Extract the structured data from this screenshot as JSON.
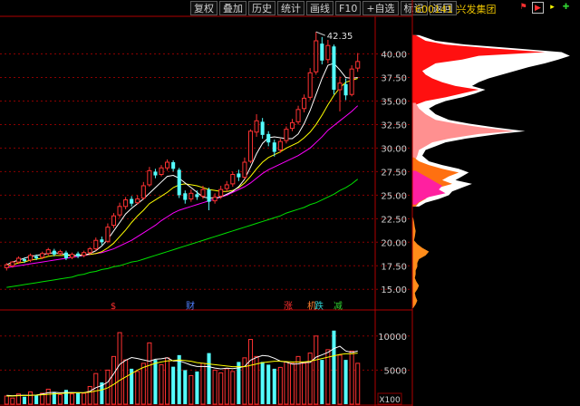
{
  "toolbar": {
    "buttons": [
      "复权",
      "叠加",
      "历史",
      "统计",
      "画线",
      "F10",
      "+自选",
      "标记",
      "返回"
    ]
  },
  "stock": {
    "code_name": "600141 兴发集团"
  },
  "price_axis": {
    "labels": [
      "40.00",
      "37.50",
      "35.00",
      "32.50",
      "30.00",
      "27.50",
      "25.00",
      "22.50",
      "20.00",
      "17.50",
      "15.00"
    ]
  },
  "annotations": {
    "high_label": "42.35"
  },
  "event_markers": [
    {
      "text": "$",
      "color": "#ff3030"
    },
    {
      "text": "财",
      "color": "#5080ff"
    },
    {
      "text": "涨",
      "color": "#ff3030"
    },
    {
      "text": "机",
      "color": "#ff8030"
    },
    {
      "text": "跌",
      "color": "#30d0d0"
    },
    {
      "text": "减",
      "color": "#30d030"
    }
  ],
  "volume_axis": {
    "labels": [
      "10000",
      "5000"
    ],
    "unit": "X100"
  },
  "colors": {
    "up": "#ff3232",
    "down": "#54fcfc",
    "ma5": "#ffffff",
    "ma10": "#ffff00",
    "ma20": "#ff00ff",
    "ma60": "#00e000"
  },
  "chart_data": {
    "type": "candlestick",
    "y_range": [
      13,
      44
    ],
    "high": 42.35,
    "candles": [
      [
        17.3,
        17.6,
        17.0,
        17.8
      ],
      [
        17.5,
        17.9,
        17.3,
        18.0
      ],
      [
        17.9,
        18.3,
        17.7,
        18.5
      ],
      [
        18.2,
        18.0,
        17.8,
        18.4
      ],
      [
        18.1,
        18.6,
        17.9,
        18.8
      ],
      [
        18.5,
        18.3,
        18.1,
        18.7
      ],
      [
        18.4,
        18.8,
        18.2,
        19.0
      ],
      [
        18.8,
        19.2,
        18.6,
        19.4
      ],
      [
        19.1,
        18.7,
        18.5,
        19.3
      ],
      [
        18.8,
        19.0,
        18.6,
        19.2
      ],
      [
        18.9,
        18.3,
        18.1,
        19.1
      ],
      [
        18.4,
        18.7,
        18.2,
        18.9
      ],
      [
        18.8,
        18.5,
        18.3,
        19.0
      ],
      [
        18.6,
        18.9,
        18.4,
        19.1
      ],
      [
        18.9,
        19.3,
        18.7,
        19.5
      ],
      [
        19.3,
        20.2,
        19.1,
        20.5
      ],
      [
        20.3,
        20.0,
        19.7,
        20.6
      ],
      [
        20.1,
        21.6,
        19.9,
        22.0
      ],
      [
        21.8,
        22.8,
        21.5,
        23.1
      ],
      [
        22.9,
        23.8,
        22.6,
        24.2
      ],
      [
        23.8,
        24.5,
        23.5,
        24.8
      ],
      [
        24.6,
        24.1,
        23.8,
        24.9
      ],
      [
        24.2,
        24.6,
        24.0,
        25.0
      ],
      [
        24.7,
        26.0,
        24.5,
        26.4
      ],
      [
        26.1,
        27.6,
        25.9,
        28.0
      ],
      [
        27.5,
        27.1,
        26.8,
        27.8
      ],
      [
        27.2,
        27.9,
        27.0,
        28.2
      ],
      [
        27.9,
        28.5,
        27.6,
        28.8
      ],
      [
        28.5,
        27.8,
        27.5,
        28.7
      ],
      [
        27.7,
        25.0,
        24.7,
        27.9
      ],
      [
        25.2,
        24.5,
        24.1,
        25.5
      ],
      [
        24.6,
        25.2,
        24.3,
        25.6
      ],
      [
        25.1,
        24.8,
        24.5,
        25.5
      ],
      [
        24.9,
        25.6,
        24.6,
        26.0
      ],
      [
        25.6,
        24.3,
        23.4,
        25.8
      ],
      [
        24.4,
        24.8,
        24.1,
        25.2
      ],
      [
        24.9,
        25.6,
        24.6,
        26.0
      ],
      [
        25.7,
        26.1,
        25.4,
        26.5
      ],
      [
        26.2,
        27.2,
        25.9,
        27.5
      ],
      [
        27.3,
        26.9,
        26.5,
        27.7
      ],
      [
        26.9,
        28.5,
        26.7,
        29.0
      ],
      [
        28.6,
        31.8,
        28.4,
        32.0
      ],
      [
        31.7,
        32.9,
        31.2,
        33.6
      ],
      [
        32.8,
        31.4,
        31.0,
        33.2
      ],
      [
        31.5,
        30.6,
        30.2,
        31.8
      ],
      [
        30.6,
        29.6,
        29.1,
        30.9
      ],
      [
        29.8,
        30.7,
        29.5,
        31.0
      ],
      [
        30.8,
        32.0,
        30.5,
        32.3
      ],
      [
        32.1,
        32.7,
        31.8,
        33.1
      ],
      [
        32.8,
        34.1,
        32.5,
        34.5
      ],
      [
        34.2,
        35.3,
        33.8,
        35.7
      ],
      [
        35.4,
        38.0,
        35.1,
        38.5
      ],
      [
        38.1,
        41.4,
        37.8,
        42.35
      ],
      [
        41.1,
        39.3,
        38.9,
        41.8
      ],
      [
        39.4,
        40.9,
        39.0,
        41.5
      ],
      [
        40.8,
        36.2,
        35.7,
        41.0
      ],
      [
        36.2,
        36.9,
        33.9,
        37.6
      ],
      [
        36.8,
        35.6,
        35.1,
        37.4
      ],
      [
        35.7,
        38.4,
        35.5,
        38.8
      ],
      [
        38.5,
        39.2,
        38.1,
        40.1
      ]
    ],
    "ma5": [
      17.6,
      17.9,
      18.1,
      18.3,
      18.5,
      18.6,
      18.7,
      18.8,
      18.9,
      18.8,
      18.7,
      18.6,
      18.6,
      18.6,
      18.8,
      19.1,
      19.6,
      20.3,
      21.2,
      22.1,
      23.0,
      23.6,
      24.1,
      24.6,
      25.2,
      25.8,
      26.4,
      27.0,
      27.1,
      26.8,
      26.3,
      25.8,
      25.3,
      24.8,
      24.7,
      24.7,
      24.8,
      25.1,
      25.4,
      25.9,
      26.7,
      28.0,
      29.4,
      30.5,
      31.1,
      31.2,
      31.1,
      31.0,
      31.0,
      31.5,
      32.6,
      34.0,
      35.7,
      37.4,
      38.8,
      39.0,
      38.3,
      37.5,
      37.4,
      37.5
    ],
    "ma10": [
      17.5,
      17.6,
      17.8,
      17.9,
      18.1,
      18.2,
      18.3,
      18.5,
      18.6,
      18.6,
      18.6,
      18.6,
      18.6,
      18.7,
      18.7,
      18.8,
      19.0,
      19.4,
      19.9,
      20.6,
      21.3,
      22.1,
      22.8,
      23.4,
      24.1,
      24.5,
      24.9,
      25.3,
      25.8,
      26.1,
      26.2,
      26.1,
      26.0,
      25.8,
      25.6,
      25.5,
      25.4,
      25.4,
      25.5,
      25.8,
      26.3,
      27.0,
      27.8,
      28.5,
      29.0,
      29.3,
      29.6,
      30.0,
      30.3,
      30.6,
      31.1,
      31.7,
      32.5,
      33.5,
      34.6,
      35.6,
      36.4,
      37.0,
      37.2,
      37.4
    ],
    "ma20": [
      17.3,
      17.4,
      17.5,
      17.6,
      17.7,
      17.8,
      17.9,
      18.0,
      18.1,
      18.2,
      18.3,
      18.4,
      18.5,
      18.6,
      18.7,
      18.8,
      18.9,
      19.1,
      19.3,
      19.6,
      19.9,
      20.2,
      20.6,
      21.0,
      21.4,
      21.8,
      22.3,
      22.7,
      23.1,
      23.4,
      23.6,
      23.8,
      24.0,
      24.2,
      24.4,
      24.6,
      24.8,
      25.0,
      25.3,
      25.6,
      25.9,
      26.3,
      26.8,
      27.3,
      27.7,
      28.0,
      28.3,
      28.6,
      28.9,
      29.2,
      29.6,
      30.0,
      30.6,
      31.2,
      31.9,
      32.4,
      32.9,
      33.4,
      33.9,
      34.5
    ],
    "ma60": [
      15.2,
      15.3,
      15.4,
      15.5,
      15.6,
      15.7,
      15.8,
      15.9,
      16.0,
      16.1,
      16.2,
      16.3,
      16.5,
      16.6,
      16.8,
      16.9,
      17.1,
      17.2,
      17.4,
      17.5,
      17.7,
      17.9,
      18.0,
      18.2,
      18.4,
      18.6,
      18.8,
      19.0,
      19.2,
      19.4,
      19.6,
      19.8,
      20.0,
      20.2,
      20.4,
      20.6,
      20.8,
      21.0,
      21.2,
      21.4,
      21.6,
      21.8,
      22.0,
      22.2,
      22.4,
      22.6,
      22.8,
      23.1,
      23.3,
      23.5,
      23.7,
      24.0,
      24.2,
      24.5,
      24.8,
      25.1,
      25.5,
      25.8,
      26.2,
      26.7
    ],
    "volume_range": [
      0,
      12500
    ],
    "volumes": [
      1200,
      900,
      1500,
      1100,
      1800,
      1300,
      1600,
      2200,
      1800,
      1400,
      2100,
      1500,
      1700,
      1600,
      2600,
      4500,
      3200,
      5000,
      7000,
      10500,
      6500,
      5200,
      4800,
      6000,
      9000,
      6500,
      5800,
      6800,
      5500,
      7200,
      5000,
      4200,
      4800,
      6000,
      7500,
      5000,
      4600,
      5200,
      4800,
      6200,
      6800,
      9500,
      7000,
      6200,
      5800,
      5200,
      5400,
      6200,
      6000,
      7000,
      6000,
      7500,
      10000,
      6500,
      8000,
      10800,
      7200,
      6500,
      7800,
      6000
    ],
    "vol_ma1": [
      1300,
      1250,
      1300,
      1320,
      1300,
      1350,
      1500,
      1680,
      1740,
      1680,
      1720,
      1720,
      1700,
      1680,
      1900,
      2420,
      2740,
      3240,
      4460,
      5840,
      6440,
      6840,
      6700,
      6500,
      6300,
      6600,
      6660,
      6820,
      6340,
      6360,
      6060,
      5740,
      5540,
      5540,
      5500,
      5300,
      5180,
      5280,
      5220,
      5340,
      5560,
      6460,
      6860,
      7140,
      7060,
      6740,
      6320,
      6160,
      5880,
      5920,
      6120,
      6140,
      6900,
      7240,
      7600,
      8160,
      8500,
      7800,
      7600,
      7800
    ],
    "vol_ma2": [
      1200,
      1200,
      1250,
      1280,
      1300,
      1330,
      1380,
      1450,
      1520,
      1560,
      1620,
      1650,
      1680,
      1700,
      1760,
      1950,
      2100,
      2400,
      2900,
      3500,
      4000,
      4500,
      5000,
      5400,
      5700,
      6000,
      6200,
      6350,
      6400,
      6500,
      6400,
      6300,
      6100,
      6000,
      5900,
      5800,
      5700,
      5600,
      5500,
      5500,
      5500,
      5700,
      5900,
      6100,
      6200,
      6300,
      6300,
      6250,
      6200,
      6200,
      6200,
      6300,
      6500,
      6700,
      6900,
      7100,
      7300,
      7400,
      7400,
      7500
    ]
  },
  "depth_profile": {
    "y_range": [
      13,
      44
    ],
    "bands": [
      {
        "color": "#ff1010",
        "points": [
          [
            42.0,
            0.02
          ],
          [
            41.4,
            0.08
          ],
          [
            41.0,
            0.2
          ],
          [
            40.6,
            0.48
          ],
          [
            40.2,
            0.8
          ],
          [
            39.8,
            0.4
          ],
          [
            39.4,
            0.3
          ],
          [
            39.0,
            0.14
          ],
          [
            38.6,
            0.1
          ],
          [
            38.2,
            0.06
          ],
          [
            37.8,
            0.08
          ],
          [
            37.4,
            0.12
          ],
          [
            37.0,
            0.18
          ],
          [
            36.6,
            0.26
          ],
          [
            36.2,
            0.4
          ],
          [
            35.8,
            0.3
          ],
          [
            35.4,
            0.2
          ],
          [
            35.0,
            0.08
          ],
          [
            34.6,
            0.02
          ]
        ]
      },
      {
        "color": "#ff9090",
        "points": [
          [
            34.8,
            0.02
          ],
          [
            34.2,
            0.04
          ],
          [
            33.6,
            0.08
          ],
          [
            33.0,
            0.14
          ],
          [
            32.6,
            0.26
          ],
          [
            32.2,
            0.42
          ],
          [
            31.8,
            0.62
          ],
          [
            31.5,
            0.4
          ],
          [
            31.0,
            0.22
          ],
          [
            30.6,
            0.12
          ],
          [
            30.2,
            0.08
          ],
          [
            29.8,
            0.04
          ],
          [
            29.2,
            0.03
          ],
          [
            28.8,
            0.02
          ]
        ]
      },
      {
        "color": "#ff7010",
        "points": [
          [
            29.0,
            0.01
          ],
          [
            28.6,
            0.04
          ],
          [
            28.2,
            0.1
          ],
          [
            27.8,
            0.18
          ],
          [
            27.4,
            0.28
          ],
          [
            27.0,
            0.22
          ],
          [
            26.6,
            0.18
          ],
          [
            26.2,
            0.24
          ],
          [
            25.8,
            0.16
          ],
          [
            25.4,
            0.12
          ],
          [
            25.0,
            0.1
          ],
          [
            24.6,
            0.08
          ],
          [
            24.2,
            0.04
          ],
          [
            23.8,
            0.02
          ]
        ]
      },
      {
        "color": "#ff20a0",
        "points": [
          [
            27.6,
            0.02
          ],
          [
            27.2,
            0.06
          ],
          [
            26.8,
            0.1
          ],
          [
            26.4,
            0.14
          ],
          [
            26.0,
            0.18
          ],
          [
            25.6,
            0.16
          ],
          [
            25.2,
            0.2
          ],
          [
            24.8,
            0.1
          ],
          [
            24.4,
            0.05
          ],
          [
            24.0,
            0.02
          ]
        ]
      },
      {
        "color": "#ff8c1a",
        "points": [
          [
            22.6,
            0.005
          ],
          [
            22.2,
            0.01
          ],
          [
            21.6,
            0.015
          ],
          [
            21.2,
            0.02
          ],
          [
            20.6,
            0.015
          ],
          [
            20.2,
            0.01
          ],
          [
            19.8,
            0.03
          ],
          [
            19.4,
            0.06
          ],
          [
            19.0,
            0.1
          ],
          [
            18.6,
            0.08
          ],
          [
            18.2,
            0.04
          ],
          [
            17.8,
            0.03
          ],
          [
            17.4,
            0.03
          ],
          [
            17.0,
            0.02
          ],
          [
            16.6,
            0.02
          ],
          [
            16.2,
            0.015
          ],
          [
            15.8,
            0.025
          ],
          [
            15.4,
            0.04
          ],
          [
            15.0,
            0.03
          ],
          [
            14.6,
            0.015
          ],
          [
            14.2,
            0.02
          ],
          [
            13.8,
            0.03
          ],
          [
            13.4,
            0.02
          ],
          [
            13.0,
            0.005
          ]
        ]
      }
    ],
    "white_outline": [
      [
        42.0,
        0.04
      ],
      [
        41.4,
        0.14
      ],
      [
        41.0,
        0.32
      ],
      [
        40.6,
        0.62
      ],
      [
        40.2,
        0.9
      ],
      [
        39.8,
        0.95
      ],
      [
        39.4,
        0.88
      ],
      [
        39.0,
        0.8
      ],
      [
        38.6,
        0.7
      ],
      [
        38.2,
        0.62
      ],
      [
        37.8,
        0.54
      ],
      [
        37.4,
        0.46
      ],
      [
        37.0,
        0.4
      ],
      [
        36.6,
        0.36
      ],
      [
        36.2,
        0.44
      ],
      [
        35.8,
        0.38
      ],
      [
        35.4,
        0.3
      ],
      [
        35.0,
        0.2
      ],
      [
        34.6,
        0.14
      ],
      [
        34.2,
        0.1
      ],
      [
        33.6,
        0.14
      ],
      [
        33.0,
        0.22
      ],
      [
        32.6,
        0.34
      ],
      [
        32.2,
        0.5
      ],
      [
        31.8,
        0.68
      ],
      [
        31.5,
        0.52
      ],
      [
        31.0,
        0.32
      ],
      [
        30.6,
        0.2
      ],
      [
        30.2,
        0.14
      ],
      [
        29.8,
        0.08
      ],
      [
        29.2,
        0.06
      ],
      [
        28.6,
        0.1
      ],
      [
        28.2,
        0.18
      ],
      [
        27.8,
        0.28
      ],
      [
        27.4,
        0.34
      ],
      [
        27.0,
        0.3
      ],
      [
        26.6,
        0.26
      ],
      [
        26.2,
        0.36
      ],
      [
        25.8,
        0.3
      ],
      [
        25.4,
        0.24
      ],
      [
        25.0,
        0.22
      ],
      [
        24.6,
        0.16
      ],
      [
        24.2,
        0.08
      ],
      [
        23.8,
        0.04
      ]
    ]
  }
}
